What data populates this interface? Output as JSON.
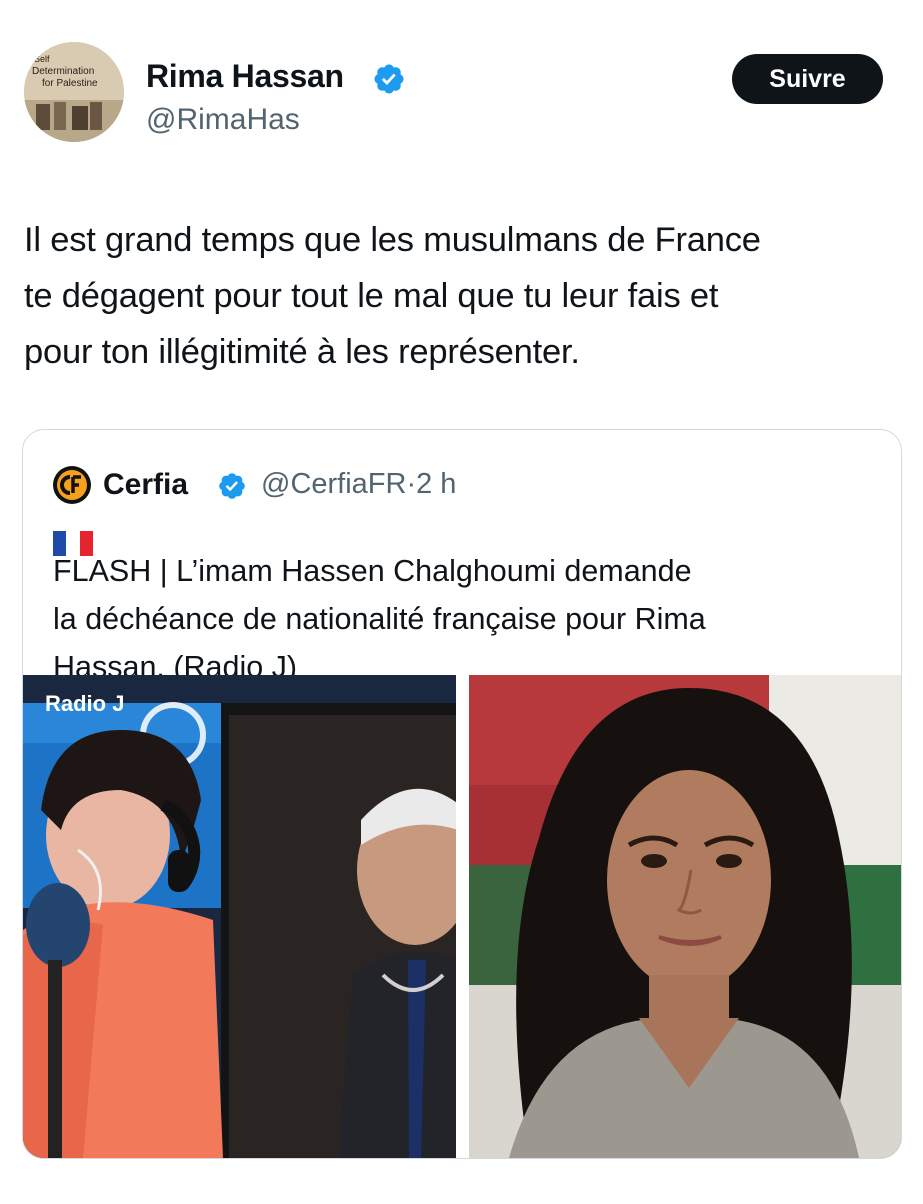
{
  "tweet": {
    "author_name": "Rima Hassan",
    "author_handle": "@RimaHas",
    "avatar_text": [
      "Self",
      "Determination",
      "for Palestine"
    ],
    "follow_label": "Suivre",
    "text_lines": [
      "Il est grand temps que les musulmans de France",
      "te dégagent pour tout le mal que tu leur fais et",
      "pour ton illégitimité à les représenter."
    ],
    "verified_icon": "verified-badge-icon"
  },
  "quoted": {
    "author_name": "Cerfia",
    "author_handle": "@CerfiaFR",
    "separator": "·",
    "time": "2 h",
    "logo_icon": "cerfia-logo",
    "flag_icon": "france-flag",
    "text_lines": [
      "FLASH | L’imam Hassen Chalghoumi demande",
      "la déchéance de nationalité française pour Rima",
      "Hassan. (Radio J)"
    ],
    "media_left_caption": "Radio J",
    "colors": {
      "accent": "#1d9bf0",
      "cerfia_orange": "#f5a11c",
      "flag_blue": "#1f4aa8",
      "flag_red": "#e4252f"
    }
  }
}
